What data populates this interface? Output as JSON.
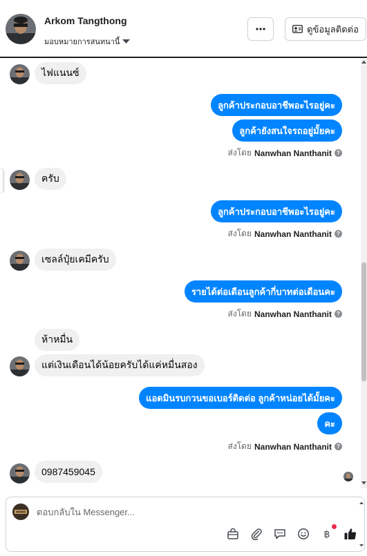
{
  "header": {
    "name": "Arkom Tangthong",
    "assign_label": "มอบหมายการสนทนานี้",
    "more_label": "···",
    "contact_label": "ดูข้อมูลติดต่อ"
  },
  "messages": {
    "m1": "ไฟแนนซ์",
    "m2": "ลูกค้าประกอบอาชีพอะไรอยู่คะ",
    "m3": "ลูกค้ายังสนใจรถอยู่มั้ยคะ",
    "m4": "ครับ",
    "m5": "ลูกค้าประกอบอาชีพอะไรอยู่คะ",
    "m6": "เซลล์ปุ๋ยเคมีครับ",
    "m7": "รายได้ต่อเดือนลูกค้ากี่บาทต่อเดือนคะ",
    "m8": "ห้าหมื่น",
    "m9": "แต่เงินเดือนได้น้อยครับได้แค่หมื่นสอง",
    "m10": "แอดมินรบกวนขอเบอร์ติดต่อ ลูกค้าหน่อยได้มั้ยคะ",
    "m11": "คะ",
    "m12": "0987459045"
  },
  "sent_by": {
    "prefix": "ส่งโดย",
    "agent": "Nanwhan Nanthanit",
    "help": "?"
  },
  "composer": {
    "placeholder": "ตอบกลับใน Messenger..."
  },
  "icons": {
    "more": "ellipsis-icon",
    "contact": "contact-card-icon",
    "assign": "caret-down-icon",
    "tools": [
      "bag-icon",
      "attach-icon",
      "saved-reply-icon",
      "emoji-icon",
      "payment-icon",
      "like-icon"
    ]
  },
  "colors": {
    "outgoing_bubble": "#0084ff",
    "incoming_bubble": "#f0f0f0",
    "like": "#1c1e21",
    "badge": "#f02849"
  }
}
